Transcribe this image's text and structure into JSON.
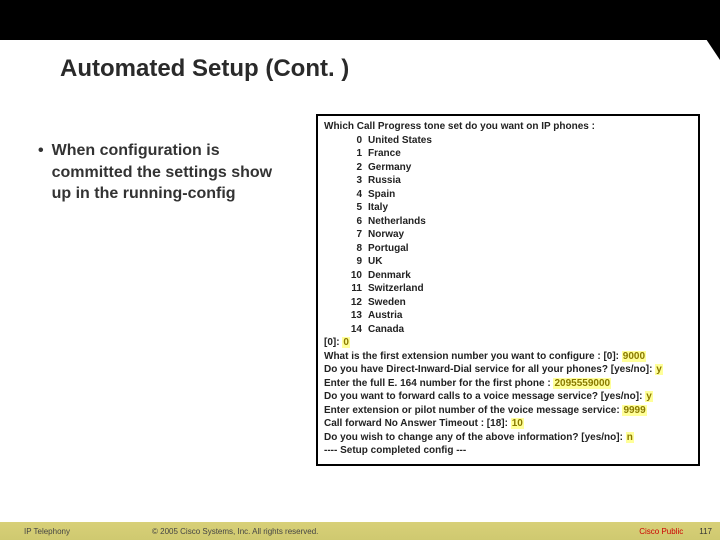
{
  "title": "Automated Setup (Cont. )",
  "bullet": "When configuration is committed the settings show up in the running-config",
  "terminal": {
    "prompt": "Which Call Progress tone set do you want on IP phones :",
    "options": [
      {
        "n": "0",
        "name": "United States"
      },
      {
        "n": "1",
        "name": "France"
      },
      {
        "n": "2",
        "name": "Germany"
      },
      {
        "n": "3",
        "name": "Russia"
      },
      {
        "n": "4",
        "name": "Spain"
      },
      {
        "n": "5",
        "name": "Italy"
      },
      {
        "n": "6",
        "name": "Netherlands"
      },
      {
        "n": "7",
        "name": "Norway"
      },
      {
        "n": "8",
        "name": "Portugal"
      },
      {
        "n": "9",
        "name": "UK"
      },
      {
        "n": "10",
        "name": "Denmark"
      },
      {
        "n": "11",
        "name": "Switzerland"
      },
      {
        "n": "12",
        "name": "Sweden"
      },
      {
        "n": "13",
        "name": "Austria"
      },
      {
        "n": "14",
        "name": "Canada"
      }
    ],
    "sel_label": "[0]: ",
    "sel_value": "0",
    "q_ext_label": "  What is the first extension number you want to configure :  [0]: ",
    "q_ext_value": "9000",
    "q_did_label": "Do you have Direct-Inward-Dial service for all your phones? [yes/no]: ",
    "q_did_value": "y",
    "q_e164_label": "  Enter the full E. 164 number for the first phone : ",
    "q_e164_value": "2095559000",
    "q_vm_label": "Do you want to forward calls to a voice message service? [yes/no]: ",
    "q_vm_value": "y",
    "q_pilot_label": "  Enter extension or pilot number of the voice message service: ",
    "q_pilot_value": "9999",
    "q_cfna_label": "  Call forward No Answer Timeout :  [18]: ",
    "q_cfna_value": "10",
    "q_change_label": "Do you wish to change any of the above information? [yes/no]: ",
    "q_change_value": "n",
    "done": "---- Setup completed config ---"
  },
  "footer": {
    "course": "IP Telephony",
    "copyright": "© 2005 Cisco Systems, Inc. All rights reserved.",
    "public": "Cisco Public",
    "page": "117"
  }
}
